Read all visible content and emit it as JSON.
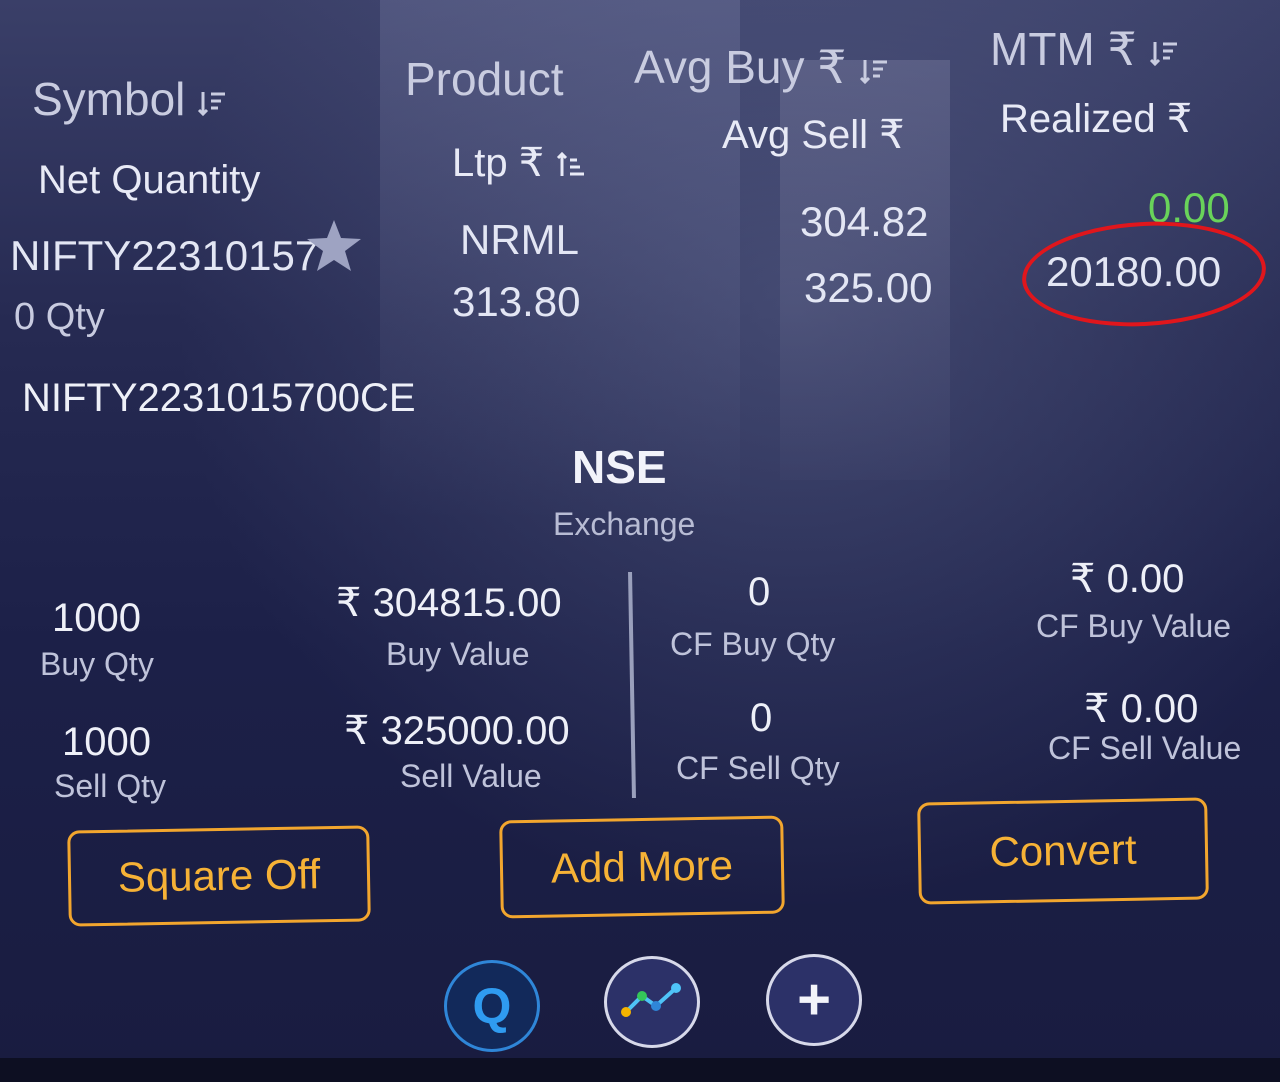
{
  "header": {
    "symbol": "Symbol",
    "net_quantity": "Net Quantity",
    "product": "Product",
    "ltp": "Ltp ₹",
    "avg_buy": "Avg Buy ₹",
    "avg_sell": "Avg Sell ₹",
    "mtm": "MTM ₹",
    "realized": "Realized ₹"
  },
  "position": {
    "symbol_truncated": "NIFTY22310157",
    "qty": "0 Qty",
    "product": "NRML",
    "ltp": "313.80",
    "avg_buy": "304.82",
    "avg_sell": "325.00",
    "mtm": "0.00",
    "realized": "20180.00",
    "full_symbol": "NIFTY2231015700CE",
    "exchange_value": "NSE",
    "exchange_label": "Exchange"
  },
  "details": {
    "buy_qty_value": "1000",
    "buy_qty_label": "Buy Qty",
    "buy_value_value": "₹ 304815.00",
    "buy_value_label": "Buy Value",
    "cf_buy_qty_value": "0",
    "cf_buy_qty_label": "CF Buy Qty",
    "cf_buy_value_value": "₹ 0.00",
    "cf_buy_value_label": "CF Buy Value",
    "sell_qty_value": "1000",
    "sell_qty_label": "Sell Qty",
    "sell_value_value": "₹ 325000.00",
    "sell_value_label": "Sell Value",
    "cf_sell_qty_value": "0",
    "cf_sell_qty_label": "CF Sell Qty",
    "cf_sell_value_value": "₹ 0.00",
    "cf_sell_value_label": "CF Sell Value"
  },
  "actions": {
    "square_off": "Square Off",
    "add_more": "Add More",
    "convert": "Convert"
  },
  "fab": {
    "q": "Q",
    "plus": "+"
  },
  "icons": {
    "sort": "sort-icon",
    "favorite": "star-icon",
    "chart": "chart-line-icon"
  },
  "colors": {
    "accent": "#f2a62e",
    "positive": "#69d35a",
    "annotation": "#e0161c",
    "fab_q": "#2f86d8"
  }
}
